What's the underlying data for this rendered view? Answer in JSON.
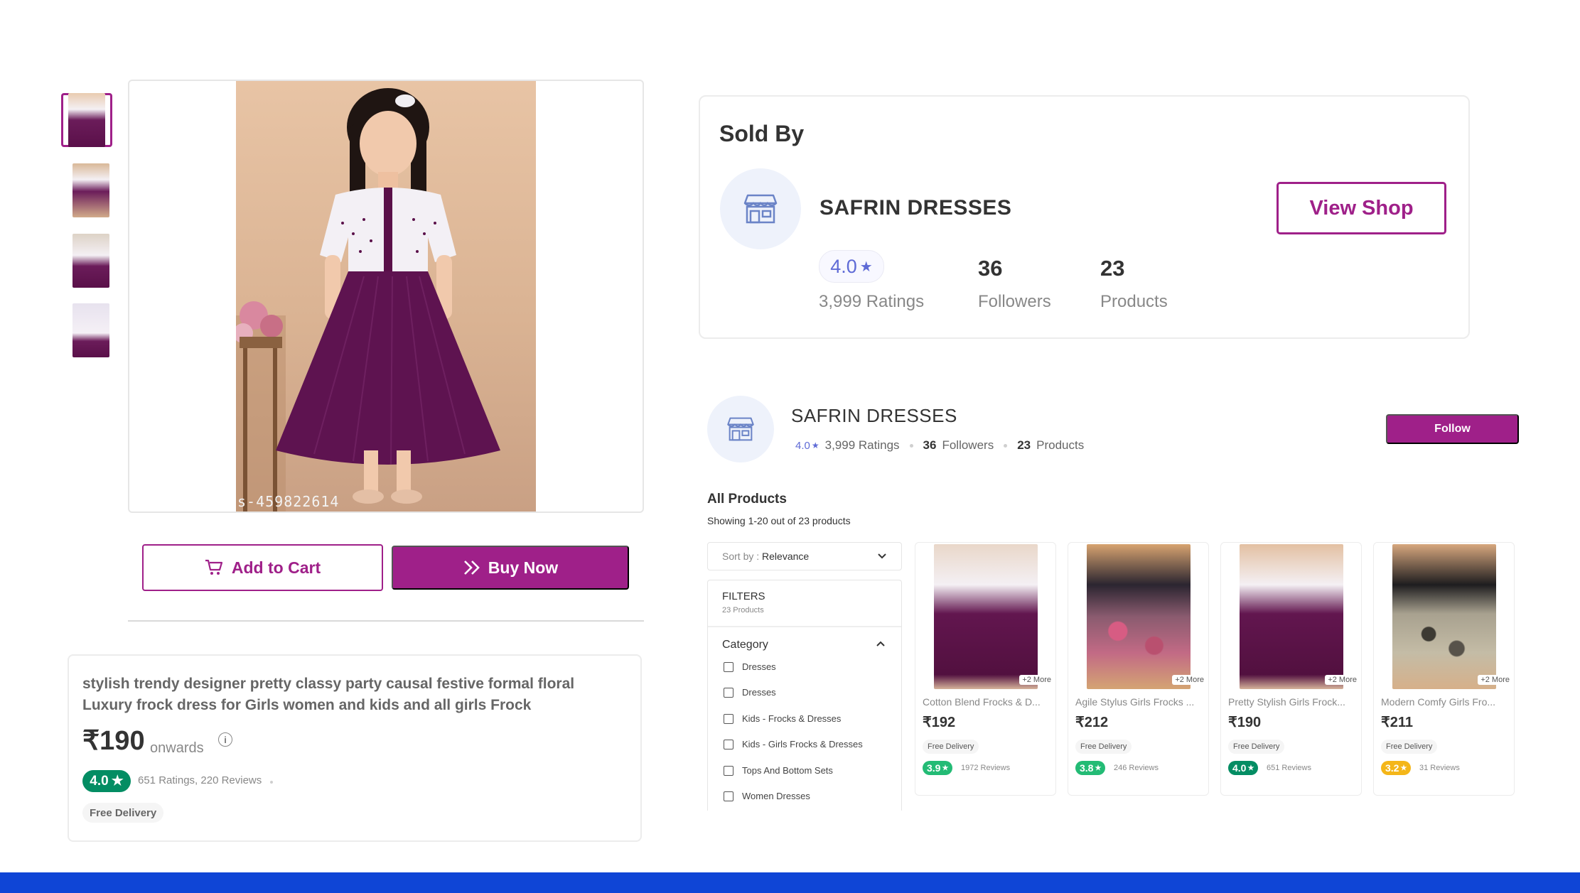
{
  "product": {
    "image_watermark": "s-459822614",
    "title": "stylish trendy designer pretty classy party causal festive formal floral Luxury frock dress for Girls women and kids and all girls Frock",
    "price": "₹190",
    "price_suffix": "onwards",
    "rating": "4.0",
    "ratings_reviews": "651 Ratings, 220 Reviews",
    "free_delivery": "Free Delivery",
    "add_to_cart": "Add to Cart",
    "buy_now": "Buy Now",
    "thumbnails": [
      "thumb-1",
      "thumb-2",
      "thumb-3",
      "thumb-4"
    ]
  },
  "sold_by": {
    "heading": "Sold By",
    "shop_name": "SAFRIN DRESSES",
    "view_shop": "View Shop",
    "rating": "4.0",
    "ratings_count": "3,999 Ratings",
    "followers_num": "36",
    "followers_lbl": "Followers",
    "products_num": "23",
    "products_lbl": "Products"
  },
  "shop_header": {
    "shop_name": "SAFRIN DRESSES",
    "rating": "4.0",
    "ratings_count": "3,999 Ratings",
    "followers_num": "36",
    "followers_lbl": "Followers",
    "products_num": "23",
    "products_lbl": "Products",
    "follow": "Follow"
  },
  "listing": {
    "title": "All Products",
    "showing": "Showing 1-20 out of 23 products",
    "sort_label": "Sort by :",
    "sort_value": "Relevance",
    "filters_title": "FILTERS",
    "filters_count": "23 Products",
    "category_title": "Category",
    "categories": [
      "Dresses",
      "Dresses",
      "Kids - Frocks & Dresses",
      "Kids - Girls Frocks & Dresses",
      "Tops And Bottom Sets",
      "Women Dresses"
    ]
  },
  "products": [
    {
      "name": "Cotton Blend Frocks & D...",
      "price": "₹192",
      "delivery": "Free Delivery",
      "rating": "3.9",
      "reviews": "1972 Reviews",
      "more": "+2 More",
      "rating_color": "#23bb75"
    },
    {
      "name": "Agile Stylus Girls Frocks ...",
      "price": "₹212",
      "delivery": "Free Delivery",
      "rating": "3.8",
      "reviews": "246 Reviews",
      "more": "+2 More",
      "rating_color": "#23bb75"
    },
    {
      "name": "Pretty Stylish Girls Frock...",
      "price": "₹190",
      "delivery": "Free Delivery",
      "rating": "4.0",
      "reviews": "651 Reviews",
      "more": "+2 More",
      "rating_color": "#038d63"
    },
    {
      "name": "Modern Comfy Girls Fro...",
      "price": "₹211",
      "delivery": "Free Delivery",
      "rating": "3.2",
      "reviews": "31 Reviews",
      "more": "+2 More",
      "rating_color": "#f4b619"
    }
  ],
  "colors": {
    "brand": "#9f2089",
    "rating_green": "#038d63",
    "bottom_bar": "#0f45d6"
  },
  "icons": {
    "cart": "cart-icon",
    "buy": "double-chevron-icon",
    "shop": "shop-icon",
    "star": "star-icon",
    "info": "info-icon",
    "chevron_down": "chevron-down-icon",
    "chevron_up": "chevron-up-icon"
  }
}
